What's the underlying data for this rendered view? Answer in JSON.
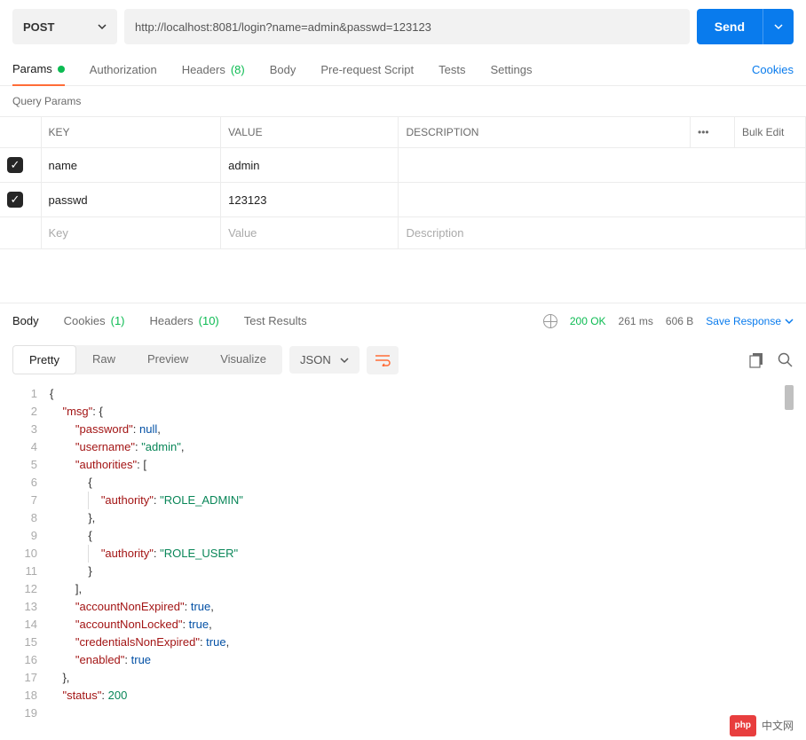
{
  "request": {
    "method": "POST",
    "url": "http://localhost:8081/login?name=admin&passwd=123123",
    "send_label": "Send"
  },
  "request_tabs": {
    "params": "Params",
    "auth": "Authorization",
    "headers_label": "Headers",
    "headers_count": "(8)",
    "body": "Body",
    "prerequest": "Pre-request Script",
    "tests": "Tests",
    "settings": "Settings",
    "cookies": "Cookies"
  },
  "query_params": {
    "section_label": "Query Params",
    "headers": {
      "key": "KEY",
      "value": "VALUE",
      "desc": "DESCRIPTION",
      "bulk": "Bulk Edit"
    },
    "rows": [
      {
        "key": "name",
        "value": "admin"
      },
      {
        "key": "passwd",
        "value": "123123"
      }
    ],
    "placeholders": {
      "key": "Key",
      "value": "Value",
      "desc": "Description"
    }
  },
  "response_tabs": {
    "body": "Body",
    "cookies_label": "Cookies",
    "cookies_count": "(1)",
    "headers_label": "Headers",
    "headers_count": "(10)",
    "test_results": "Test Results"
  },
  "status": {
    "code": "200 OK",
    "time": "261 ms",
    "size": "606 B",
    "save": "Save Response"
  },
  "view_tabs": {
    "pretty": "Pretty",
    "raw": "Raw",
    "preview": "Preview",
    "visualize": "Visualize",
    "format": "JSON"
  },
  "code_lines": [
    [
      [
        "punct",
        "{"
      ]
    ],
    [
      [
        "sp",
        "    "
      ],
      [
        "k",
        "\"msg\""
      ],
      [
        "punct",
        ": {"
      ]
    ],
    [
      [
        "sp",
        "        "
      ],
      [
        "k",
        "\"password\""
      ],
      [
        "punct",
        ": "
      ],
      [
        "v-null",
        "null"
      ],
      [
        "punct",
        ","
      ]
    ],
    [
      [
        "sp",
        "        "
      ],
      [
        "k",
        "\"username\""
      ],
      [
        "punct",
        ": "
      ],
      [
        "v-str",
        "\"admin\""
      ],
      [
        "punct",
        ","
      ]
    ],
    [
      [
        "sp",
        "        "
      ],
      [
        "k",
        "\"authorities\""
      ],
      [
        "punct",
        ": ["
      ]
    ],
    [
      [
        "sp",
        "            "
      ],
      [
        "punct",
        "{"
      ]
    ],
    [
      [
        "sp",
        "            "
      ],
      [
        "guide",
        ""
      ],
      [
        "sp",
        "   "
      ],
      [
        "k",
        "\"authority\""
      ],
      [
        "punct",
        ": "
      ],
      [
        "v-str",
        "\"ROLE_ADMIN\""
      ]
    ],
    [
      [
        "sp",
        "            "
      ],
      [
        "punct",
        "},"
      ]
    ],
    [
      [
        "sp",
        "            "
      ],
      [
        "punct",
        "{"
      ]
    ],
    [
      [
        "sp",
        "            "
      ],
      [
        "guide",
        ""
      ],
      [
        "sp",
        "   "
      ],
      [
        "k",
        "\"authority\""
      ],
      [
        "punct",
        ": "
      ],
      [
        "v-str",
        "\"ROLE_USER\""
      ]
    ],
    [
      [
        "sp",
        "            "
      ],
      [
        "punct",
        "}"
      ]
    ],
    [
      [
        "sp",
        "        "
      ],
      [
        "punct",
        "],"
      ]
    ],
    [
      [
        "sp",
        "        "
      ],
      [
        "k",
        "\"accountNonExpired\""
      ],
      [
        "punct",
        ": "
      ],
      [
        "v-bool",
        "true"
      ],
      [
        "punct",
        ","
      ]
    ],
    [
      [
        "sp",
        "        "
      ],
      [
        "k",
        "\"accountNonLocked\""
      ],
      [
        "punct",
        ": "
      ],
      [
        "v-bool",
        "true"
      ],
      [
        "punct",
        ","
      ]
    ],
    [
      [
        "sp",
        "        "
      ],
      [
        "k",
        "\"credentialsNonExpired\""
      ],
      [
        "punct",
        ": "
      ],
      [
        "v-bool",
        "true"
      ],
      [
        "punct",
        ","
      ]
    ],
    [
      [
        "sp",
        "        "
      ],
      [
        "k",
        "\"enabled\""
      ],
      [
        "punct",
        ": "
      ],
      [
        "v-bool",
        "true"
      ]
    ],
    [
      [
        "sp",
        "    "
      ],
      [
        "punct",
        "},"
      ]
    ],
    [
      [
        "sp",
        "    "
      ],
      [
        "k",
        "\"status\""
      ],
      [
        "punct",
        ": "
      ],
      [
        "v-num",
        "200"
      ]
    ],
    [
      [
        "punct",
        ""
      ]
    ]
  ],
  "watermark": {
    "badge": "php",
    "text": "中文网"
  }
}
